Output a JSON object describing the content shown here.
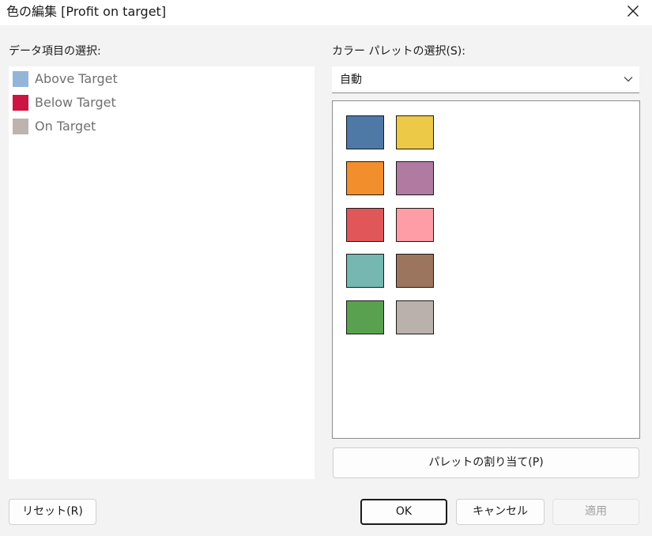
{
  "window": {
    "title": "色の編集 [Profit on target]"
  },
  "left_panel": {
    "label": "データ項目の選択:",
    "items": [
      {
        "label": "Above Target",
        "color": "#93b6d8"
      },
      {
        "label": "Below Target",
        "color": "#cc1540"
      },
      {
        "label": "On Target",
        "color": "#bdb3af"
      }
    ]
  },
  "right_panel": {
    "label": "カラー パレットの選択(S):",
    "palette_selected": "自動",
    "swatches": [
      "#4e79a7",
      "#edc948",
      "#f28e2b",
      "#b07aa1",
      "#e15759",
      "#ff9da7",
      "#76b7b2",
      "#9c755f",
      "#59a14f",
      "#bab0ac"
    ],
    "assign_button": "パレットの割り当て(P)"
  },
  "footer": {
    "reset": "リセット(R)",
    "ok": "OK",
    "cancel": "キャンセル",
    "apply": "適用"
  },
  "icons": {
    "close": "close-icon",
    "dropdown": "chevron-down-icon"
  }
}
